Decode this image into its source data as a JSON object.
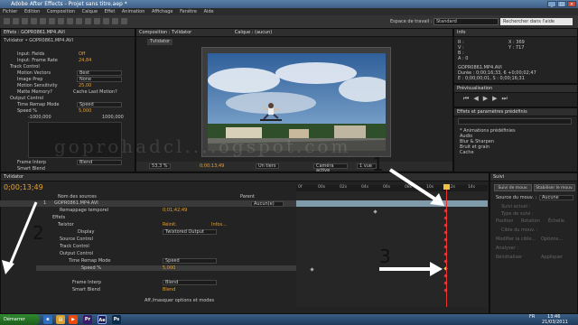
{
  "window": {
    "title": "Adobe After Effects - Projet sans titre.aep *"
  },
  "menu": [
    "Fichier",
    "Edition",
    "Composition",
    "Calque",
    "Effet",
    "Animation",
    "Affichage",
    "Fenêtre",
    "Aide"
  ],
  "workspace": {
    "label": "Espace de travail :",
    "value": "Standard",
    "search_placeholder": "Rechercher dans l'aide"
  },
  "effects_panel": {
    "tab": "Effets : GOPR0861.MP4.AVI",
    "layer_path": "Tvlidator • GOPR0861.MP4.AVI",
    "rows": {
      "input_fields": "Input: Fields",
      "input_fields_val": "Off",
      "input_frame_rate": "Input: Frame Rate",
      "input_frame_rate_val": "24,84",
      "track_control": "Track Control",
      "motion_vectors": "Motion Vectors",
      "motion_vectors_val": "Best",
      "image_prep": "Image Prep",
      "image_prep_val": "None",
      "motion_sensitivity": "Motion Sensitivity",
      "motion_sensitivity_val": "25,00",
      "matte_memory": "Matte Memory?",
      "cache_last": "Cache Last Motion?",
      "output_control": "Output Control",
      "time_remap_mode": "Time Remap Mode",
      "time_remap_mode_val": "Speed",
      "speed": "Speed %",
      "speed_val": "5,000",
      "graph_min": "-1000,000",
      "graph_max": "1000,000",
      "frame_interp": "Frame Interp",
      "frame_interp_val": "Blend",
      "smart_blend": "Smart Blend",
      "smart_blend_val": "Blend"
    }
  },
  "composition_panel": {
    "tab": "Composition : Tvlidator",
    "layer_tab": "Calque : (aucun)",
    "comp_label": "Tvlidator",
    "zoom": "53,3 %",
    "timecode": "0;00;13;49",
    "resolution": "Un tiers",
    "camera": "Caméra active",
    "views": "1 vue"
  },
  "info_panel": {
    "tab": "Info",
    "r": "R :",
    "v": "V :",
    "b": "B :",
    "a": "A : 0",
    "x": "X : 369",
    "y": "Y : 717",
    "file": "GOPR0861.MP4.AVI",
    "duree": "Durée : 0;00;16;33, 6 +0;00;02;47",
    "entree": "E : 0;00;00;01, S : 0;00;16;31"
  },
  "preview_panel": {
    "tab": "Prévisualisation"
  },
  "effects_presets": {
    "tab": "Effets et paramètres prédéfinis",
    "items": [
      "* Animations prédéfinies",
      "Audio",
      "Blur & Sharpen",
      "Bruit et grain",
      "Cache"
    ]
  },
  "timeline": {
    "tab": "Tvlidator",
    "timecode": "0;00;13;49",
    "col_source": "Nom des sources",
    "col_parent": "Parent",
    "layer_num": "1",
    "layer_name": "GOPR0861.MP4.AVI",
    "parent_val": "Aucun(e)",
    "remap": "Remappage temporel",
    "remap_val": "0;01;42;49",
    "effets": "Effets",
    "twixtor": "Twixtor",
    "reinit": "Réinit.",
    "infos": "Infos...",
    "display": "Display",
    "display_val": "Twixtored Output",
    "source_control": "Source Control",
    "track_control": "Track Control",
    "output_control": "Output Control",
    "time_remap_mode": "Time Remap Mode",
    "time_remap_val": "Speed",
    "speed": "Speed %",
    "speed_val": "5,000",
    "frame_interp": "Frame Interp",
    "frame_interp_val": "Blend",
    "smart_blend": "Smart Blend",
    "smart_blend_val": "Blend",
    "footer": "Aff./masquer options et modes",
    "ruler": [
      "0f",
      "00s",
      "02s",
      "04s",
      "06s",
      "08s",
      "10s",
      "12s",
      "14s",
      "16s"
    ]
  },
  "tracker_panel": {
    "tab": "Suivi",
    "btn_track": "Suivi de mouv.",
    "btn_stab": "Stabiliser le mouv.",
    "source_label": "Source du mouv. :",
    "source_val": "Aucune",
    "rows": [
      "Suivi actuel :",
      "Type de suivi :",
      "Position",
      "Rotation",
      "Échelle",
      "Cible du mouv. :",
      "Modifier la cible...",
      "Options...",
      "Analyser :",
      "Réinitialiser",
      "Appliquer"
    ]
  },
  "taskbar": {
    "start": "Démarrer",
    "time": "13:46",
    "date": "21/03/2011",
    "lang": "FR"
  },
  "watermark": "goprohadcl....ogspot.com",
  "annotations": [
    "1",
    "2",
    "3"
  ]
}
